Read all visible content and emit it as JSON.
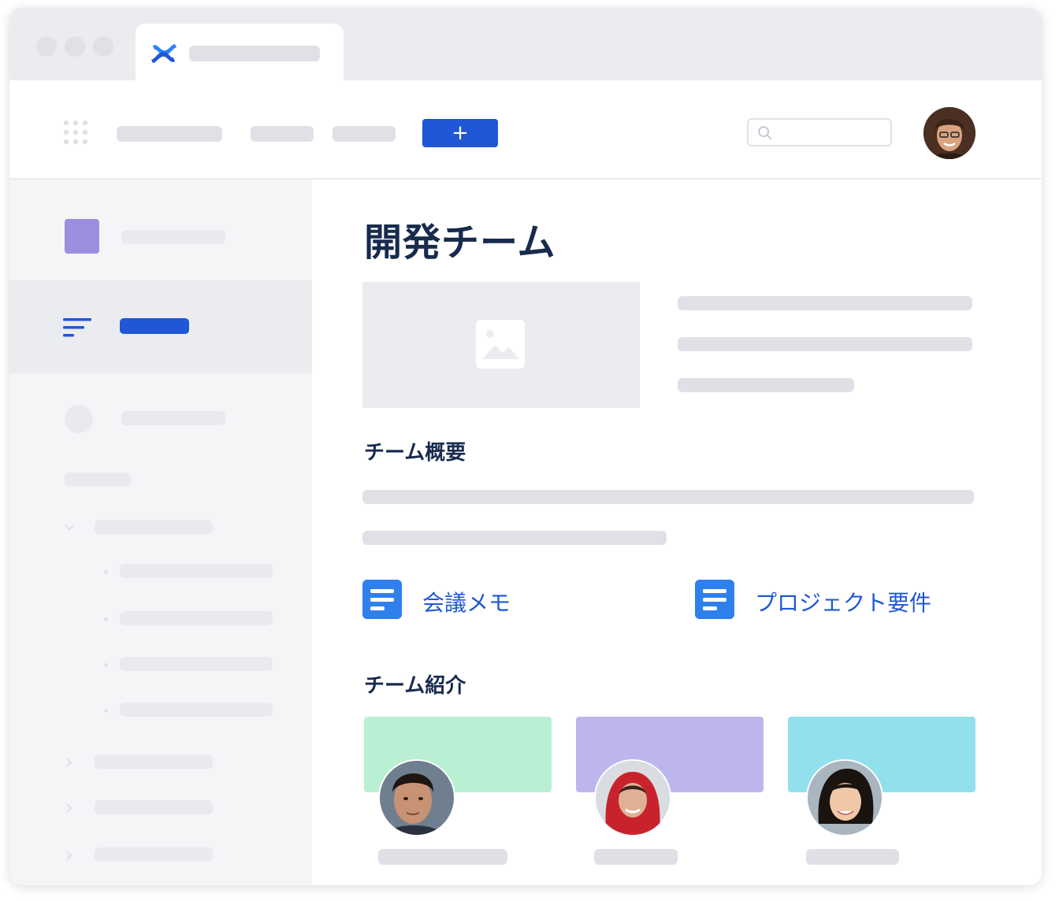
{
  "app": {
    "logo_icon": "confluence-logo-icon",
    "accent_color": "#1f57d6"
  },
  "toolbar": {
    "create_label": "+",
    "apps_icon": "app-grid-icon",
    "search_icon": "search-icon"
  },
  "sidebar": {
    "space_icon_color": "#9b8fe0",
    "active_item_icon": "list-lines-icon"
  },
  "page": {
    "title": "開発チーム",
    "overview_heading": "チーム概要",
    "links": [
      {
        "label": "会議メモ",
        "icon": "document-icon"
      },
      {
        "label": "プロジェクト要件",
        "icon": "document-icon"
      }
    ],
    "team_heading": "チーム紹介",
    "team_cards": [
      {
        "color": "#b9f0d4"
      },
      {
        "color": "#bdb6ec"
      },
      {
        "color": "#92e0eb"
      }
    ]
  }
}
